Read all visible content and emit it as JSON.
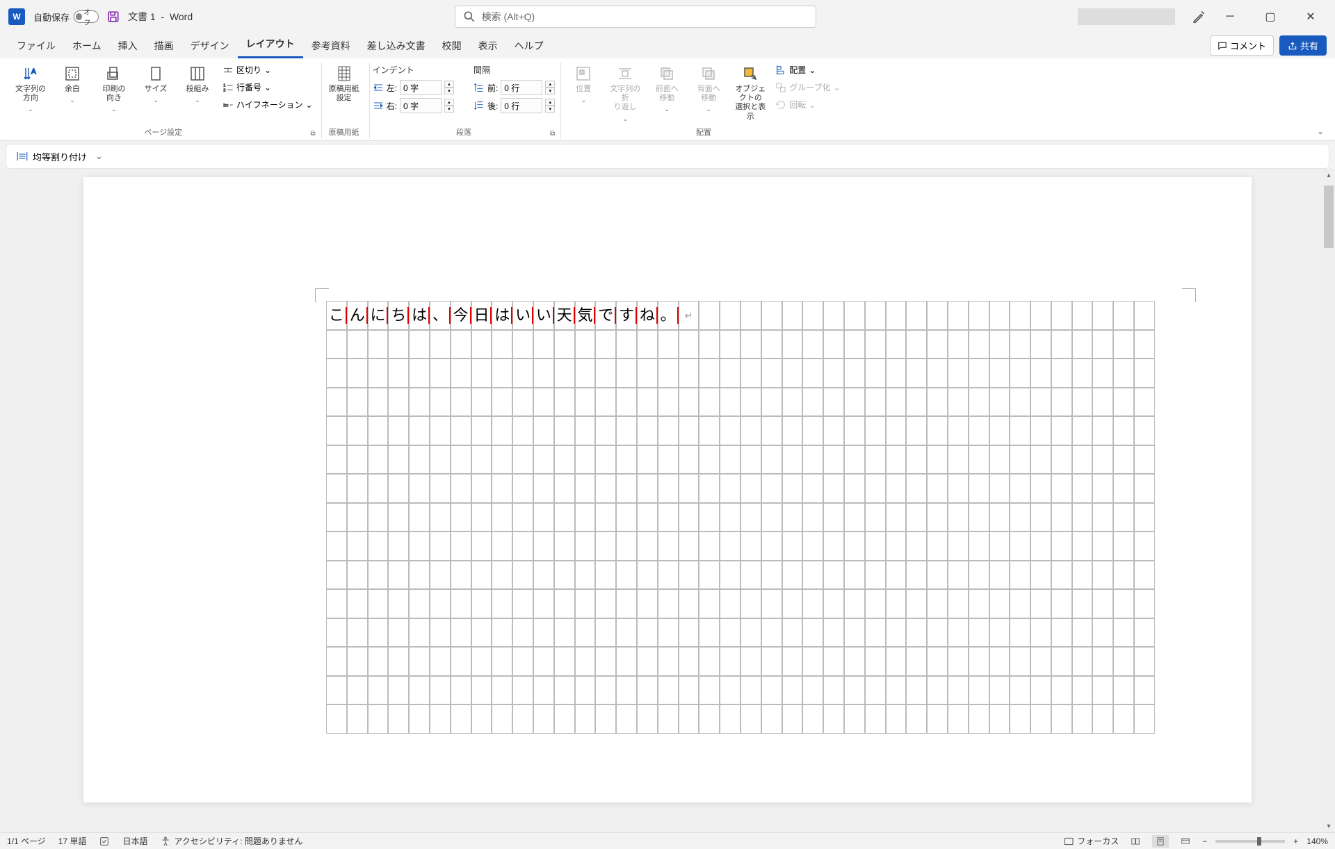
{
  "titlebar": {
    "autosave_label": "自動保存",
    "autosave_state": "オフ",
    "doc_title": "文書 1",
    "app_name": "Word",
    "search_placeholder": "検索 (Alt+Q)"
  },
  "tabs": {
    "items": [
      "ファイル",
      "ホーム",
      "挿入",
      "描画",
      "デザイン",
      "レイアウト",
      "参考資料",
      "差し込み文書",
      "校閲",
      "表示",
      "ヘルプ"
    ],
    "active_index": 5,
    "comments": "コメント",
    "share": "共有"
  },
  "ribbon": {
    "page_setup": {
      "text_direction": "文字列の\n方向",
      "margins": "余白",
      "orientation": "印刷の\n向き",
      "size": "サイズ",
      "columns": "段組み",
      "breaks": "区切り",
      "line_numbers": "行番号",
      "hyphenation": "ハイフネーション",
      "label": "ページ設定"
    },
    "genko": {
      "button": "原稿用紙\n設定",
      "label": "原稿用紙"
    },
    "paragraph": {
      "indent_header": "インデント",
      "spacing_header": "間隔",
      "left_label": "左:",
      "right_label": "右:",
      "before_label": "前:",
      "after_label": "後:",
      "left_value": "0 字",
      "right_value": "0 字",
      "before_value": "0 行",
      "after_value": "0 行",
      "label": "段落"
    },
    "arrange": {
      "position": "位置",
      "wrap": "文字列の折\nり返し",
      "bring_forward": "前面へ\n移動",
      "send_backward": "背面へ\n移動",
      "selection_pane": "オブジェクトの\n選択と表示",
      "align": "配置",
      "group": "グループ化",
      "rotate": "回転",
      "label": "配置"
    }
  },
  "qat": {
    "distribute": "均等割り付け"
  },
  "document": {
    "text": [
      "こ",
      "ん",
      "に",
      "ち",
      "は",
      "、",
      "今",
      "日",
      "は",
      "い",
      "い",
      "天",
      "気",
      "で",
      "す",
      "ね",
      "。"
    ],
    "columns": 40,
    "rows": 15
  },
  "statusbar": {
    "page": "1/1 ページ",
    "words": "17 単語",
    "language": "日本語",
    "accessibility": "アクセシビリティ: 問題ありません",
    "focus": "フォーカス",
    "zoom": "140%"
  }
}
